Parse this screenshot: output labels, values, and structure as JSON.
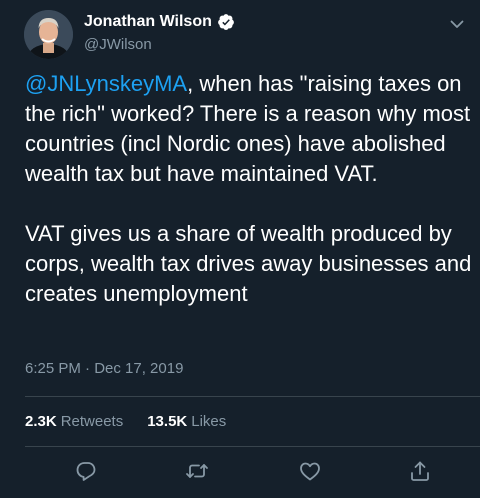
{
  "author": {
    "name": "Jonathan Wilson",
    "handle": "@JWilson",
    "verified_icon": "verified-badge-icon"
  },
  "tweet": {
    "mention": "@JNLynskeyMA",
    "paragraph1_rest": ", when has \"raising taxes on the rich\" worked? There is a reason why most countries (incl Nordic ones) have abolished wealth tax but have maintained VAT.",
    "paragraph2": "VAT gives us a share of wealth produced by corps, wealth tax drives away businesses and creates unemployment",
    "timestamp": "6:25 PM · Dec 17, 2019"
  },
  "stats": {
    "retweets_count": "2.3K",
    "retweets_label": "Retweets",
    "likes_count": "13.5K",
    "likes_label": "Likes"
  },
  "actions": [
    "reply-icon",
    "retweet-icon",
    "like-icon",
    "share-icon"
  ],
  "colors": {
    "background": "#15202b",
    "accent": "#1da1f2",
    "secondary_text": "#8899a6",
    "divider": "#38444d"
  }
}
